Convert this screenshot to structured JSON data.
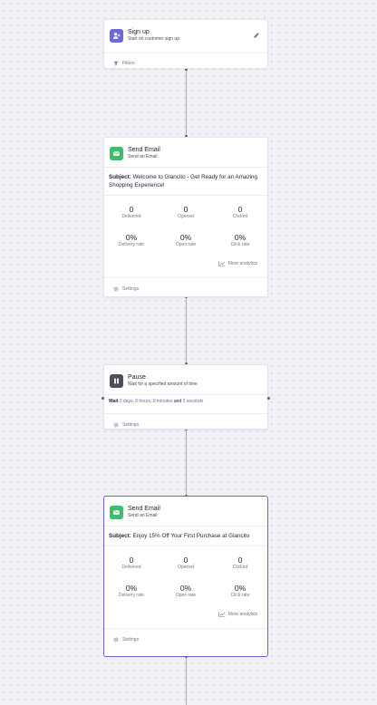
{
  "signup": {
    "title": "Sign up",
    "subtitle": "Start on customer sign up",
    "filters_label": "Filters"
  },
  "email1": {
    "title": "Send Email",
    "subtitle": "Send an Email",
    "subject_label": "Subject:",
    "subject_text": "Welcome to Glancito - Get Ready for an Amazing Shopping Experience!",
    "stats_counts": [
      {
        "value": "0",
        "label": "Delivered"
      },
      {
        "value": "0",
        "label": "Opened"
      },
      {
        "value": "0",
        "label": "Clicked"
      }
    ],
    "stats_rates": [
      {
        "value": "0%",
        "label": "Delivery rate"
      },
      {
        "value": "0%",
        "label": "Open rate"
      },
      {
        "value": "0%",
        "label": "Click rate"
      }
    ],
    "more_analytics": "More analytics",
    "settings_label": "Settings"
  },
  "pause": {
    "title": "Pause",
    "subtitle": "Wait for a specified amount of time",
    "wait_label": "Wait",
    "days": "2 days,",
    "hours": "0 hours,",
    "minutes": "0 minutes",
    "and": "and",
    "seconds": "0 seconds",
    "settings_label": "Settings"
  },
  "email2": {
    "title": "Send Email",
    "subtitle": "Send an Email",
    "subject_label": "Subject:",
    "subject_text": "Enjoy 15% Off Your First Purchase at Glancito",
    "stats_counts": [
      {
        "value": "0",
        "label": "Delivered"
      },
      {
        "value": "0",
        "label": "Opened"
      },
      {
        "value": "0",
        "label": "Clicked"
      }
    ],
    "stats_rates": [
      {
        "value": "0%",
        "label": "Delivery rate"
      },
      {
        "value": "0%",
        "label": "Open rate"
      },
      {
        "value": "0%",
        "label": "Click rate"
      }
    ],
    "more_analytics": "More analytics",
    "settings_label": "Settings"
  },
  "colors": {
    "accent": "#6f62db",
    "trigger_icon": "#7268dc",
    "email_icon": "#3fbd6a",
    "pause_icon": "#4d4f5c"
  },
  "icons": [
    "user-plus-icon",
    "pencil-icon",
    "filter-icon",
    "mail-icon",
    "chart-icon",
    "gear-icon",
    "pause-icon"
  ]
}
